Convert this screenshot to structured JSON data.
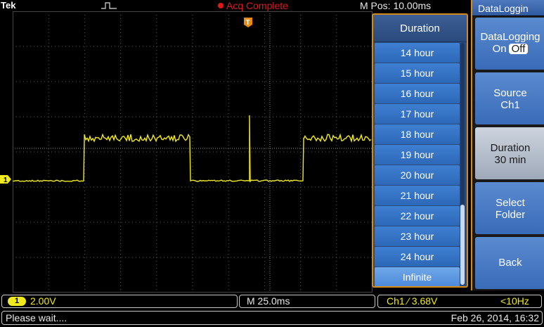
{
  "top": {
    "brand": "Tek",
    "acq_status": "Acq Complete",
    "m_pos": "M Pos: 10.00ms"
  },
  "popup": {
    "title": "Duration",
    "items": [
      "14 hour",
      "15 hour",
      "16 hour",
      "17 hour",
      "18 hour",
      "19 hour",
      "20 hour",
      "21 hour",
      "22 hour",
      "23 hour",
      "24 hour",
      "Infinite"
    ],
    "selected_index": 11
  },
  "side_menu": {
    "title": "DataLoggin",
    "datalogging_label": "DataLogging",
    "on_label": "On",
    "off_label": "Off",
    "source_label": "Source",
    "source_value": "Ch1",
    "duration_label": "Duration",
    "duration_value": "30 min",
    "select_label": "Select",
    "folder_label": "Folder",
    "back_label": "Back"
  },
  "channel": {
    "number": "1",
    "volts_div": "2.00V",
    "color": "#f2ea1c"
  },
  "timebase": "M 25.0ms",
  "trigger": {
    "info": "Ch1 ⁄ 3.68V",
    "freq": "<10Hz"
  },
  "status": {
    "message": "Please wait....",
    "datetime": "Feb 26, 2014, 16:32"
  },
  "trigger_marker_label": "T",
  "colors": {
    "accent_orange": "#d48a18",
    "trace": "#f2ea1c",
    "menu_blue": "#3f7fd1",
    "acq_red": "#e01818"
  }
}
